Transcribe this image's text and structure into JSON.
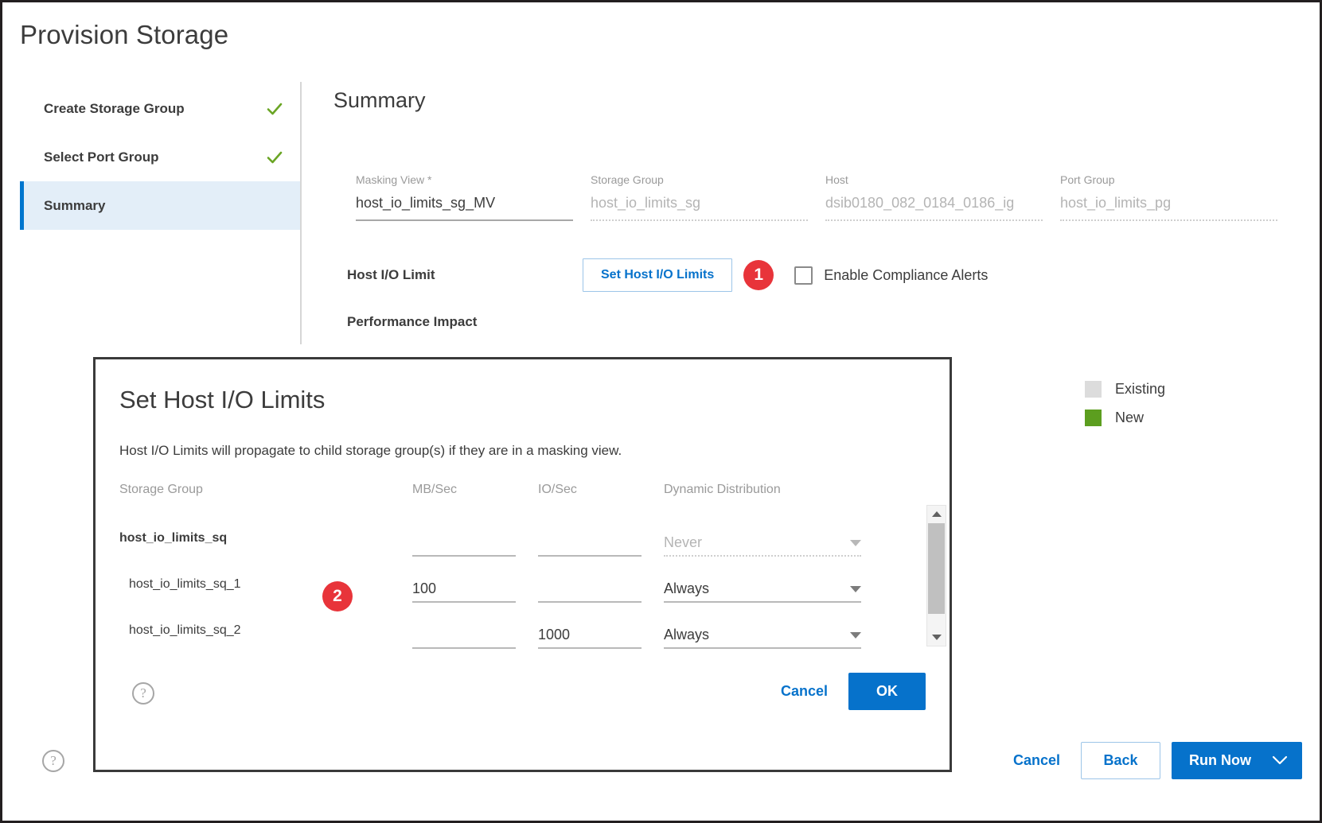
{
  "page": {
    "title": "Provision Storage",
    "help_icon": "help-circle-icon"
  },
  "wizard": {
    "steps": [
      {
        "label": "Create Storage Group",
        "state": "complete",
        "icon": "check-icon"
      },
      {
        "label": "Select Port Group",
        "state": "complete",
        "icon": "check-icon"
      },
      {
        "label": "Summary",
        "state": "active",
        "icon": ""
      }
    ]
  },
  "summary": {
    "heading": "Summary",
    "fields": [
      {
        "label": "Masking View *",
        "value": "host_io_limits_sg_MV",
        "readonly": false
      },
      {
        "label": "Storage Group",
        "value": "host_io_limits_sg",
        "readonly": true
      },
      {
        "label": "Host",
        "value": "dsib0180_082_0184_0186_ig",
        "readonly": true
      },
      {
        "label": "Port Group",
        "value": "host_io_limits_pg",
        "readonly": true
      }
    ],
    "host_io_limit_label": "Host I/O Limit",
    "set_host_io_limits_button": "Set Host I/O Limits",
    "callout_1": "1",
    "compliance_checkbox_label": "Enable Compliance Alerts",
    "compliance_checkbox_checked": false,
    "performance_impact_label": "Performance Impact"
  },
  "legend": {
    "items": [
      {
        "label": "Existing",
        "color": "#dcdcdc"
      },
      {
        "label": "New",
        "color": "#5c9e1f"
      }
    ]
  },
  "modal": {
    "title": "Set Host I/O Limits",
    "description": "Host I/O Limits will propagate to child storage group(s) if they are in a masking view.",
    "callout_2": "2",
    "columns": [
      "Storage Group",
      "MB/Sec",
      "IO/Sec",
      "Dynamic Distribution"
    ],
    "rows": [
      {
        "storage_group": "host_io_limits_sq",
        "level": "parent",
        "mb_sec": "",
        "io_sec": "",
        "dynamic_distribution": "Never",
        "dynamic_disabled": true
      },
      {
        "storage_group": "host_io_limits_sq_1",
        "level": "child",
        "mb_sec": "100",
        "io_sec": "",
        "dynamic_distribution": "Always",
        "dynamic_disabled": false
      },
      {
        "storage_group": "host_io_limits_sq_2",
        "level": "child",
        "mb_sec": "",
        "io_sec": "1000",
        "dynamic_distribution": "Always",
        "dynamic_disabled": false
      }
    ],
    "scrollbar": {
      "up_icon": "scroll-up-arrow-icon",
      "down_icon": "scroll-down-arrow-icon"
    },
    "help_icon": "help-circle-icon",
    "cancel_label": "Cancel",
    "ok_label": "OK"
  },
  "footer": {
    "cancel_label": "Cancel",
    "back_label": "Back",
    "run_now_label": "Run Now",
    "run_now_caret": "chevron-down-icon"
  },
  "colors": {
    "accent_blue": "#0672cb",
    "nav_active_bar": "#0076ce",
    "nav_active_bg": "#e3eef8",
    "check_green": "#6aa524",
    "badge_red": "#e8343a",
    "new_green": "#5c9e1f",
    "existing_gray": "#dcdcdc"
  }
}
